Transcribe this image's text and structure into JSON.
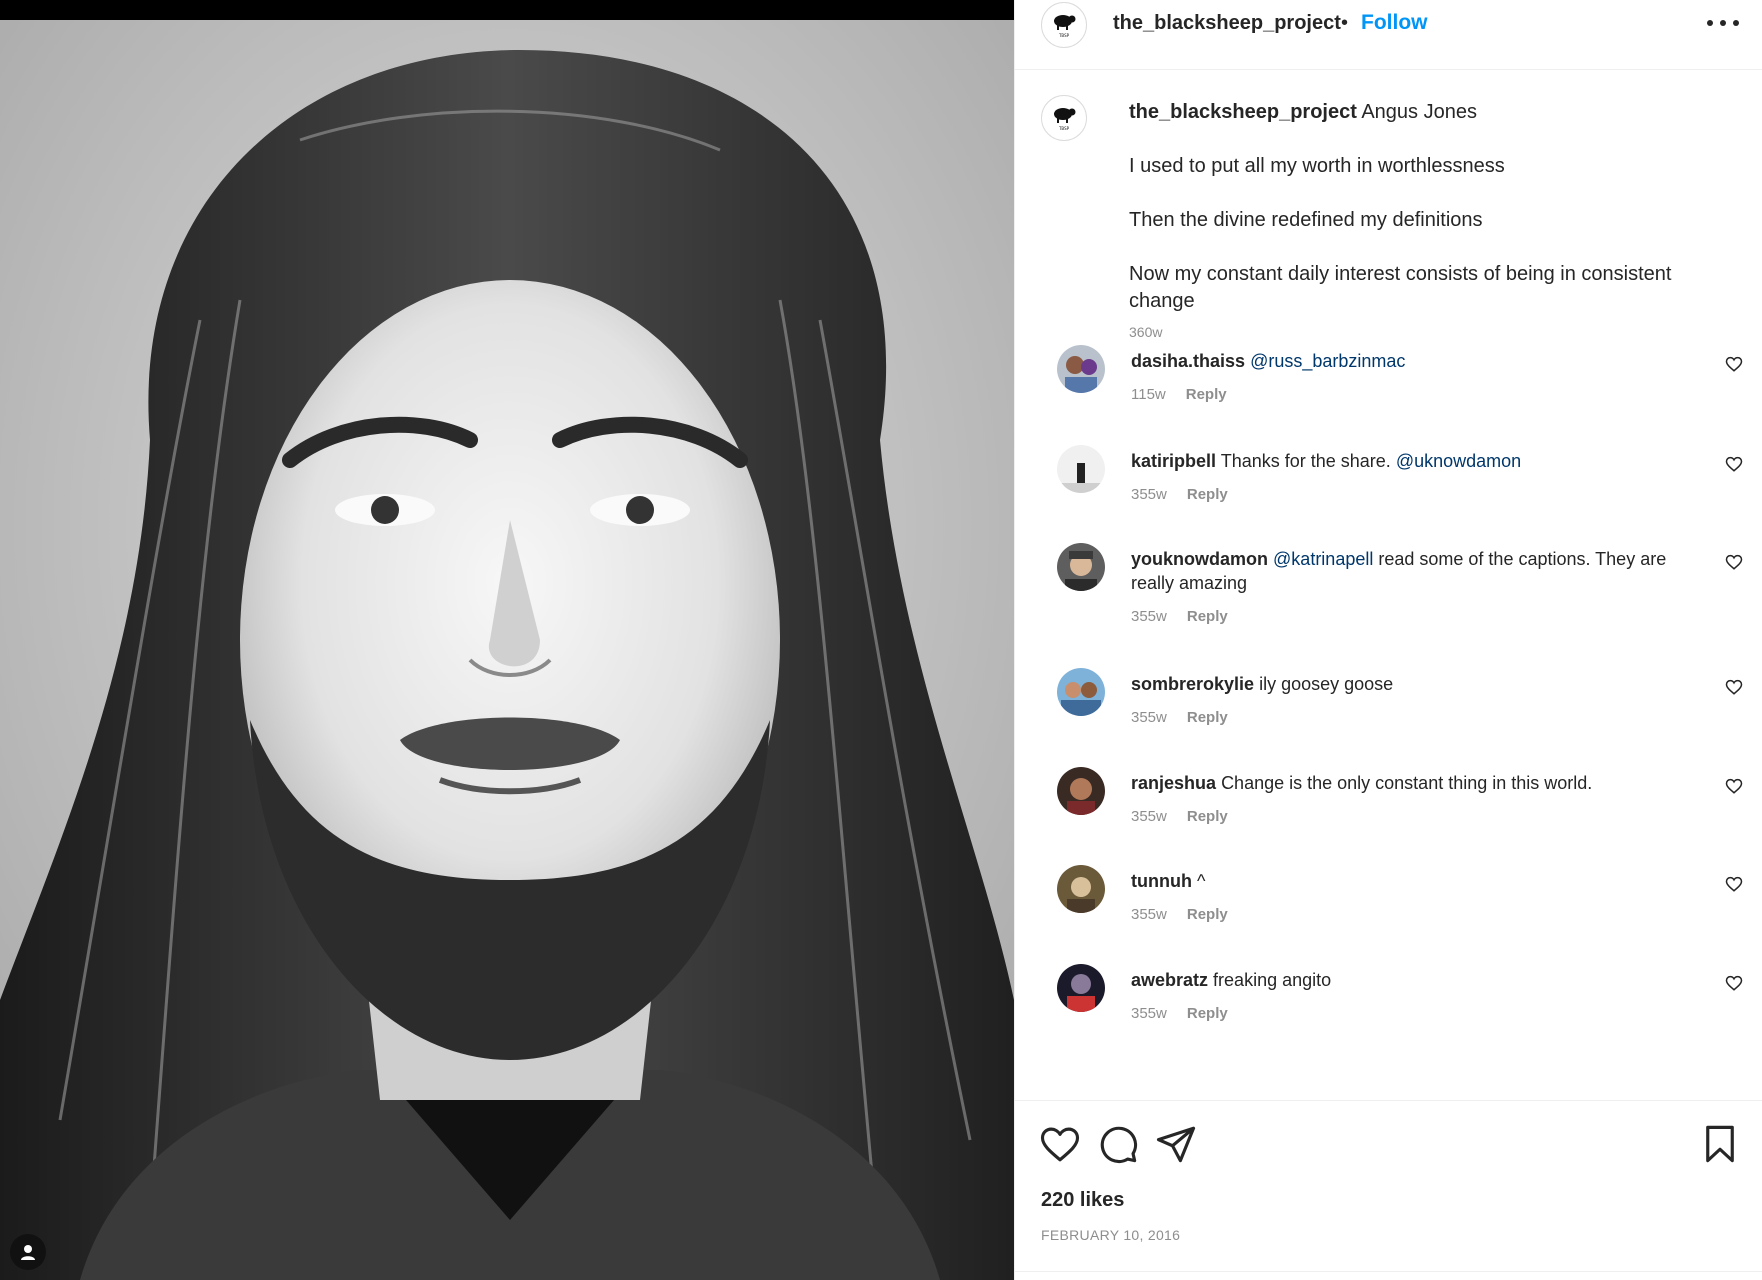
{
  "post": {
    "username": "the_blacksheep_project",
    "separator": "•",
    "follow_label": "Follow",
    "brand_mark": "TBSP",
    "likes": "220 likes",
    "date": "FEBRUARY 10, 2016"
  },
  "caption": {
    "username": "the_blacksheep_project",
    "title": "Angus Jones",
    "lines": [
      "I used to put all my worth in worthlessness",
      "Then the divine redefined my definitions",
      "Now my constant daily interest consists of being in consistent change"
    ],
    "time": "360w"
  },
  "comments": [
    {
      "user": "dasiha.thaiss",
      "mention": "@russ_barbzinmac",
      "text": "",
      "time": "115w",
      "reply": "Reply"
    },
    {
      "user": "katiripbell",
      "text": "Thanks for the share.",
      "mention": "@uknowdamon",
      "time": "355w",
      "reply": "Reply"
    },
    {
      "user": "youknowdamon",
      "mention": "@katrinapell",
      "text": "read some of the captions. They are really amazing",
      "time": "355w",
      "reply": "Reply"
    },
    {
      "user": "sombrerokylie",
      "text": "ily goosey goose",
      "mention": "",
      "time": "355w",
      "reply": "Reply"
    },
    {
      "user": "ranjeshua",
      "text": "Change is the only constant thing in this world.",
      "mention": "",
      "time": "355w",
      "reply": "Reply"
    },
    {
      "user": "tunnuh",
      "text": "^",
      "mention": "",
      "time": "355w",
      "reply": "Reply"
    },
    {
      "user": "awebratz",
      "text": "freaking angito",
      "mention": "",
      "time": "355w",
      "reply": "Reply"
    }
  ],
  "icons": {
    "like": "heart-icon",
    "comment": "comment-bubble-icon",
    "share": "paper-plane-icon",
    "save": "bookmark-icon",
    "more": "more-options-icon",
    "tags": "user-tag-icon"
  },
  "colors": {
    "accent": "#0095f6",
    "mention": "#00376b",
    "muted": "#8e8e8e",
    "text": "#262626"
  }
}
